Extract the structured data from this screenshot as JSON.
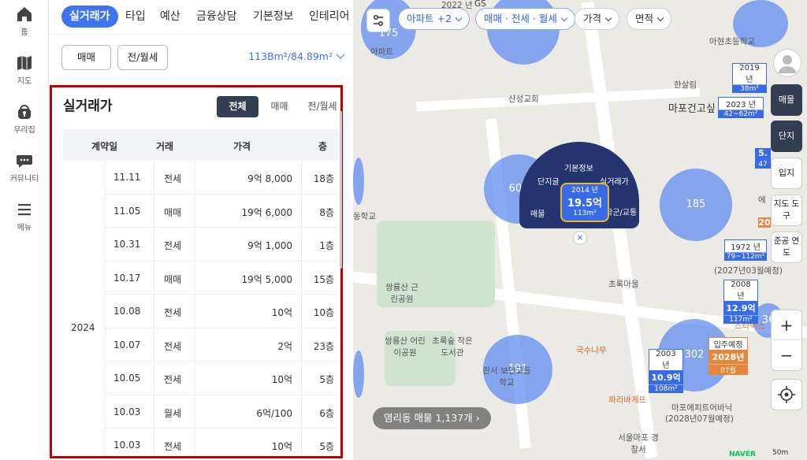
{
  "nav": {
    "items": [
      {
        "label": "홈",
        "icon": "home-icon"
      },
      {
        "label": "지도",
        "icon": "map-icon"
      },
      {
        "label": "우리집",
        "icon": "house-lock-icon"
      },
      {
        "label": "커뮤니티",
        "icon": "chat-icon"
      },
      {
        "label": "메뉴",
        "icon": "hamburger-icon"
      }
    ]
  },
  "panel": {
    "tabs": [
      "실거래가",
      "타입",
      "예산",
      "금융상담",
      "기본정보",
      "인테리어"
    ],
    "deal_buttons": [
      "매매",
      "전/월세"
    ],
    "area_selector": "113Bm²/84.89m²",
    "box": {
      "title": "실거래가",
      "filters": [
        "전체",
        "매매",
        "전/월세"
      ],
      "columns": [
        "계약일",
        "거래",
        "가격",
        "층"
      ],
      "year": "2024",
      "rows": [
        {
          "date": "11.11",
          "type": "전세",
          "price": "9억 8,000",
          "floor": "18층"
        },
        {
          "date": "11.05",
          "type": "매매",
          "price": "19억 6,000",
          "floor": "8층"
        },
        {
          "date": "10.31",
          "type": "전세",
          "price": "9억 1,000",
          "floor": "1층"
        },
        {
          "date": "10.17",
          "type": "매매",
          "price": "19억 5,000",
          "floor": "15층"
        },
        {
          "date": "10.08",
          "type": "전세",
          "price": "10억",
          "floor": "10층"
        },
        {
          "date": "10.07",
          "type": "전세",
          "price": "2억",
          "floor": "23층"
        },
        {
          "date": "10.05",
          "type": "전세",
          "price": "10억",
          "floor": "5층"
        },
        {
          "date": "10.03",
          "type": "월세",
          "price": "6억/100",
          "floor": "6층"
        },
        {
          "date": "10.03",
          "type": "전세",
          "price": "10억",
          "floor": "5층"
        }
      ]
    }
  },
  "map": {
    "filters": [
      "아파트 +2",
      "매매 · 전세 · 월세",
      "가격",
      "면적"
    ],
    "popup": {
      "top": "기본정보",
      "left_top": "단지글",
      "right_top": "실거래가",
      "left_bottom": "매물",
      "right_bottom": "학군/교통",
      "year": "2014 년",
      "price": "19.5억",
      "size": "113m²"
    },
    "circles": [
      "175",
      "609",
      "185",
      "191",
      "302",
      "36"
    ],
    "labels": [
      "아현초등학교",
      "한살림",
      "산성교회",
      "마포건고싶",
      "초록마을",
      "쌍룡산 근린공원",
      "쌍룡산 어린이공원",
      "초록숲 작은도서관",
      "국수나무",
      "파리바게뜨",
      "마포에피트어바닉",
      "(2028년07월예정)",
      "서울마포 경찰서",
      "아파트",
      "동학교",
      "한서 보인고등학교",
      "(2027년03월예정)",
      "스타벅스"
    ],
    "markers": [
      {
        "year": "2019 년",
        "price": "",
        "size": "38m²"
      },
      {
        "year": "2023 년",
        "price": "",
        "size": "42~62m²"
      },
      {
        "year": "1972 년",
        "price": "",
        "size": "79~112m²"
      },
      {
        "year": "2008 년",
        "price": "12.9억",
        "size": "117m²"
      },
      {
        "year": "2003 년",
        "price": "10.9억",
        "size": "108m²"
      },
      {
        "year": "입주예정",
        "price": "2028년",
        "size": "07월"
      }
    ],
    "side_buttons": [
      "매물",
      "단지",
      "입지",
      "지도 도구",
      "준공 연도"
    ],
    "zoom_in": "+",
    "zoom_out": "−",
    "listing_count": "염리동 매물 1,137개 ›",
    "provider": "NAVER",
    "scale": "50m",
    "partial_labels": [
      "2022 년",
      "GS",
      "5.",
      "47",
      "20",
      "에"
    ]
  }
}
